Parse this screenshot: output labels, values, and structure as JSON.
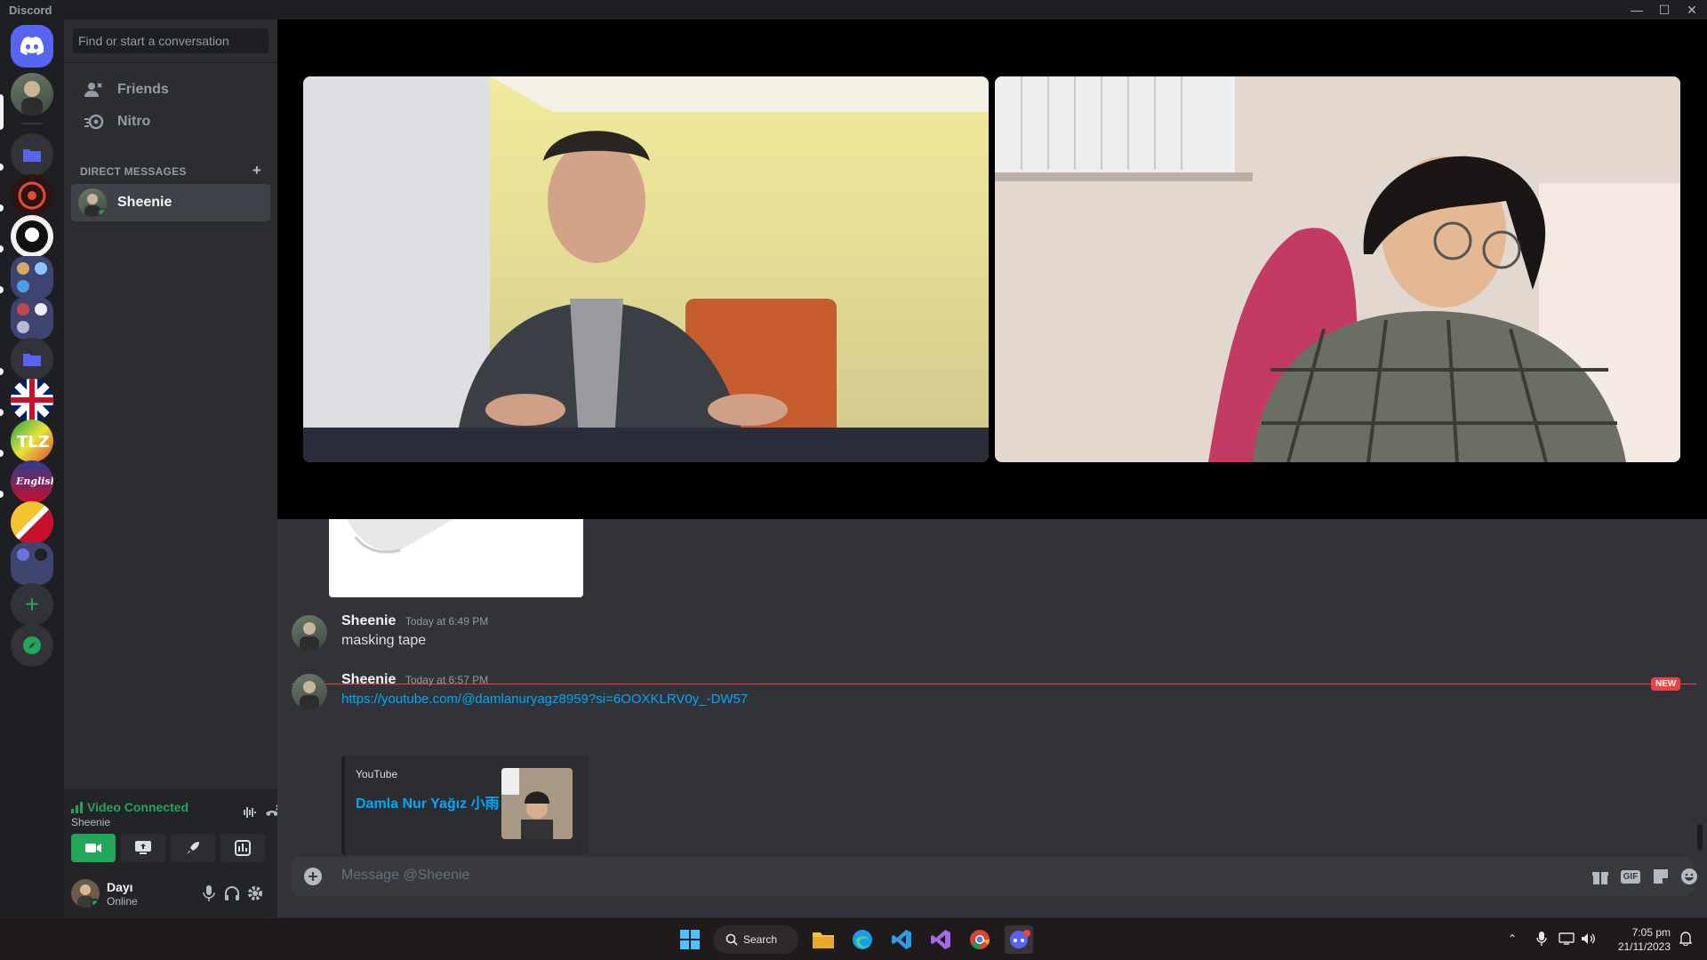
{
  "window": {
    "title": "Discord",
    "controls": [
      "minimize",
      "maximize",
      "close"
    ]
  },
  "dm_sidebar": {
    "search_placeholder": "Find or start a conversation",
    "nav": [
      {
        "label": "Friends",
        "icon": "friends-icon"
      },
      {
        "label": "Nitro",
        "icon": "nitro-icon"
      }
    ],
    "direct_messages_header": "DIRECT MESSAGES",
    "conversations": [
      {
        "name": "Sheenie",
        "status": "online"
      }
    ]
  },
  "voice": {
    "status": "Video Connected",
    "channel": "Sheenie",
    "buttons": [
      "camera",
      "screen-share",
      "activity",
      "soundboard"
    ]
  },
  "user": {
    "name": "Dayı",
    "status": "Online"
  },
  "chat": {
    "messages": [
      {
        "author": "Sheenie",
        "time": "Today at 6:49 PM",
        "text": "masking tape"
      },
      {
        "author": "Sheenie",
        "time": "Today at 6:57 PM",
        "link": "https://youtube.com/@damlanuryagz8959?si=6OOXKLRV0y_-DW57"
      }
    ],
    "new_badge": "NEW",
    "embed": {
      "provider": "YouTube",
      "title": "Damla Nur Yağız 小雨"
    },
    "composer_placeholder": "Message @Sheenie",
    "composer_buttons": [
      "gift-icon",
      "GIF",
      "sticker-icon",
      "emoji-icon"
    ]
  },
  "taskbar": {
    "search_label": "Search",
    "time": "7:05 pm",
    "date": "21/11/2023"
  },
  "colors": {
    "accent_green": "#23a55a",
    "link_blue": "#00a8fc",
    "new_red": "#f23f43",
    "blurple": "#5865f2"
  }
}
